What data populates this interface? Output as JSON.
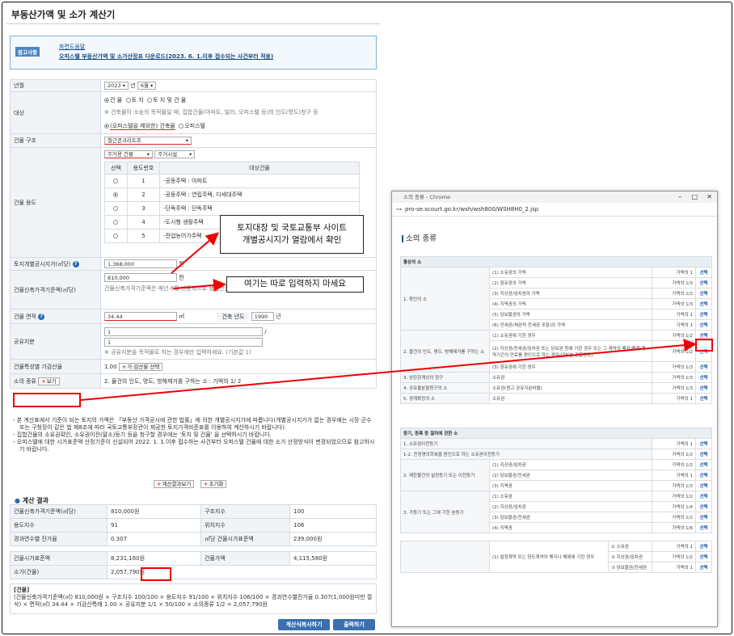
{
  "page_title": "부동산가액 및 소가 계산기",
  "notice": {
    "label": "참고사항",
    "links": [
      "화면도움말",
      "오피스텔 부동산가액 및 소가산정표 다운로드(2023. 6. 1.이후 접수되는 사건부터 적용)"
    ]
  },
  "form": {
    "year_label": "년월",
    "year_value": "2023",
    "year_unit": "년",
    "month_value": "6월",
    "target_label": "대상",
    "target_options": [
      "건 물",
      "토 지",
      "토 지 및 건 물"
    ],
    "target_note": "※ 건축물이 소송의 목적물일 때, 집합건물(아파트, 빌라, 오피스텔 등)의 인도(명도)청구 등",
    "building_type_options": [
      "(오피스텔을 제외한) 건축물",
      "오피스텔"
    ],
    "structure_label": "건물 구조",
    "structure_value": "철근콘크리트조",
    "use_label": "건물 용도",
    "use_sel1": "주거용 건물",
    "use_sel2": "주거시설",
    "use_table_headers": [
      "선택",
      "용도번호",
      "대상건물"
    ],
    "use_rows": [
      {
        "no": "1",
        "name": "-공동주택 : 아파트"
      },
      {
        "no": "2",
        "name": "-공동주택 : 연립주택, 다세대주택"
      },
      {
        "no": "3",
        "name": "-단독주택 : 단독주택"
      },
      {
        "no": "4",
        "name": "-도시형 생활주택"
      },
      {
        "no": "5",
        "name": "-전업농어가주택"
      }
    ],
    "land_price_label": "토지개별공시지가(㎡당)",
    "land_price_value": "1,368,000",
    "won": "원",
    "std_price_label": "건물신축가격기준액(㎡당)",
    "std_price_value": "810,000",
    "std_price_note": "건물신축가격기준액은 매년 6월 변동되므로 행정안전부에 문의하여 얼마인지 확인한 후 계산하세요.",
    "area_label": "건물 면적",
    "area_value": "34.44",
    "area_unit": "㎡",
    "built_year_label": "건축 년도",
    "built_year_value": "1990",
    "built_year_unit": "년",
    "share_label": "공유지분",
    "share_num": "1",
    "share_den": "1",
    "share_slash": "/",
    "share_note": "※ 공유지분을 목적물로 하는 경우에만 입력하세요. (기본값 1)",
    "adj_label": "건물특성별 가감산율",
    "adj_value": "1.00",
    "adj_btn": "가·감산율 선택",
    "suit_label": "소의 종류",
    "suit_btn": "보기",
    "suit_value": "2. 물건의 인도, 명도, 방해제거를 구하는 소 : 가액의 1/ 2"
  },
  "notes": [
    "- 본 계산표에서 기준이 되는 토지의 가액은 「부동산 가격공시에 관한 법률」에 의한 개별공시지가에 따릅니다(개별공시지가가 없는 경우에는 시장·군수 또는 구청장이 같은 법 제8조에 따라 국토교통부장관이 제공한 토지가격비준표를 이용하여 계산하시기 바랍니다).",
    "- 집합건물의 소유권확인, 소유권이전(말소)등기 등을 청구할 경우에는 '토지 및 건물' 을 선택하시기 바랍니다.",
    "- 오피스텔에 대한 시가표준액 산정기준이 신설되어 2022. 1. 1.이후 접수하는 사건부터 오피스텔 건물에 대한 소가 산정방식이 변경되었으므로 참고하시기 바랍니다."
  ],
  "buttons": {
    "calc_view": "계산결과보기",
    "reset": "초기화",
    "calc_copy": "계산식복사하기",
    "print": "출력하기"
  },
  "result": {
    "title": "계산 결과",
    "rows": [
      [
        "건물신축가격기준액(㎡당)",
        "810,000원",
        "구조지수",
        "100"
      ],
      [
        "용도지수",
        "91",
        "위치지수",
        "106"
      ],
      [
        "경과연수별 잔가율",
        "0.307",
        "㎡당 건물시가표준액",
        "239,000원"
      ]
    ],
    "total_label": "건물시가표준액",
    "total_value": "8,231,160원",
    "bldg_price_label": "건물가액",
    "bldg_price_value": "4,115,580원",
    "suit_price_label": "소가(건물)",
    "suit_price_value": "2,057,790원",
    "formula_title": "[건물]",
    "formula": "(건물신축가격기준액(㎡) 810,000원 × 구조지수 100/100 × 용도지수 91/100 × 위치지수 106/100 × 경과연수별잔가율 0.307(1,000원미만 절삭) × 면적(㎡) 34.44 × 가감산특례 1.00 × 공유지분 1/1 × 50/100 × 소의종류 1/2 = 2,057,790원"
  },
  "callouts": {
    "c1_line1": "토지대장 및 국토교통부 사이트",
    "c1_line2": "개별공시지가 열람에서 확인",
    "c2": "여기는 따로 입력하지 마세요"
  },
  "popup": {
    "window_title": "소의 종류 - Chrome",
    "url": "pro-se.scourt.go.kr/wsh/wsh800/WSH8H0_2.jsp",
    "heading": "소의 종류",
    "pick": "선택",
    "groups": [
      {
        "title": "통상의 소",
        "rows": [
          {
            "cat": "1. 확인의 소",
            "item": "(1) 소유권의 가액",
            "frac": "가액의 1"
          },
          {
            "cat": "",
            "item": "(2) 점유권의 가액",
            "frac": "가액의 1/3"
          },
          {
            "cat": "",
            "item": "(3) 지상권/임차권의 가액",
            "frac": "가액의 1/2"
          },
          {
            "cat": "",
            "item": "(4) 지역권의 가액",
            "frac": "가액의 1/3"
          },
          {
            "cat": "",
            "item": "(5) 담보물권의 가액",
            "frac": "가액의 1"
          },
          {
            "cat": "",
            "item": "(6) 전세권(채권적 전세권 포함)의 가액",
            "frac": "가액의 1"
          },
          {
            "cat": "2. 물건의 인도, 명도, 방해제거를 구하는 소",
            "item": "(1) 소유권에 기한 경우",
            "frac": "가액의 1/2"
          },
          {
            "cat": "",
            "item": "(2) 지상권/전세권/임차권 또는 담보권 등에 기한 경우 또는 그 계약의 해지/해제/계약기간의 만료를 원인으로 하는 경우(대부분 건물명도)",
            "frac": "가액의 1/2"
          },
          {
            "cat": "",
            "item": "(3) 점유권에 기한 경우",
            "frac": "가액의 1/3"
          },
          {
            "cat": "3. 상린관계상의 청구",
            "item": "소유권",
            "frac": "가액의 1/3"
          },
          {
            "cat": "4. 공유물분할청구의 소",
            "item": "소유권(원고 공유지분비율)",
            "frac": "가액의 1/3"
          },
          {
            "cat": "5. 경계확정의 소",
            "item": "소유권",
            "frac": "가액의 1"
          }
        ]
      },
      {
        "title": "등기, 등록 등 절차에 관한 소",
        "rows": [
          {
            "cat": "1. 소유권이전등기",
            "item": "",
            "frac": "가액의 1"
          },
          {
            "cat": "1-2. 진정명의회복을 원인으로 하는 소유권이전등기",
            "item": "",
            "frac": "가액의 1/2"
          },
          {
            "cat": "2. 제한물건의 설정등기 또는 이전등기",
            "item": "(1) 지상권/임차권",
            "frac": "가액의 1/2"
          },
          {
            "cat": "",
            "item": "(2) 담보물권/전세권",
            "frac": "가액의 1"
          },
          {
            "cat": "",
            "item": "(3) 지역권",
            "frac": "가액의 1/3"
          },
          {
            "cat": "3. 가등기 또는 그에 기한 본등기",
            "item": "(1) 소유권",
            "frac": "가액의 1/2"
          },
          {
            "cat": "",
            "item": "(2) 지상권/임차권",
            "frac": "가액의 1/4"
          },
          {
            "cat": "",
            "item": "(3) 담보물권/전세권",
            "frac": "가액의 1/2"
          },
          {
            "cat": "",
            "item": "(4) 지역권",
            "frac": "가액의 1/6"
          }
        ]
      }
    ],
    "sub_rows": [
      {
        "cat": "(1) 설정계약 또는 양도계약의 해지나 해제에 기한 경우",
        "sub": "① 소유권",
        "frac": "가액의 1"
      },
      {
        "cat": "",
        "sub": "② 지상권/임차권",
        "frac": "가액의 1/2"
      },
      {
        "cat": "",
        "sub": "③ 담보물권/전세권",
        "frac": "가액의 1"
      }
    ]
  }
}
